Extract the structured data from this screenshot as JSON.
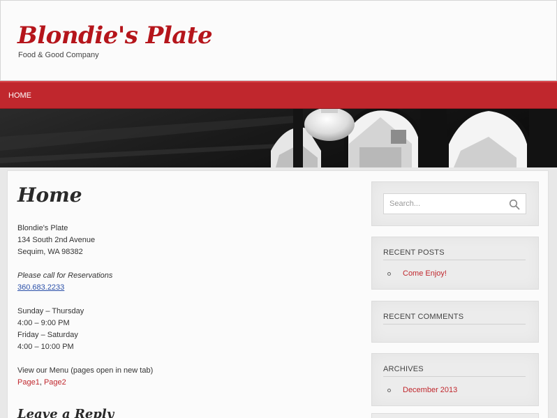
{
  "header": {
    "site_title": "Blondie's Plate",
    "tagline": "Food & Good Company"
  },
  "nav": {
    "items": [
      {
        "label": "HOME"
      }
    ]
  },
  "page": {
    "title": "Home",
    "address": [
      "Blondie's Plate",
      "134 South 2nd Avenue",
      "Sequim, WA 98382"
    ],
    "reservation_note": "Please call for Reservations",
    "phone": "360.683.2233",
    "hours": [
      "Sunday – Thursday",
      "4:00 – 9:00 PM",
      "Friday – Saturday",
      "4:00 – 10:00 PM"
    ],
    "menu_note": "View our Menu (pages open in new tab)",
    "menu_links": [
      "Page1",
      "Page2"
    ],
    "menu_separator": ", ",
    "reply_title": "Leave a Reply"
  },
  "sidebar": {
    "search": {
      "placeholder": "Search..."
    },
    "recent_posts": {
      "title": "RECENT POSTS",
      "items": [
        "Come Enjoy!"
      ]
    },
    "recent_comments": {
      "title": "RECENT COMMENTS"
    },
    "archives": {
      "title": "ARCHIVES",
      "items": [
        "December 2013"
      ]
    }
  },
  "colors": {
    "brand_red": "#c0272d",
    "title_red": "#b5151b",
    "link_blue": "#2a4fa8"
  }
}
